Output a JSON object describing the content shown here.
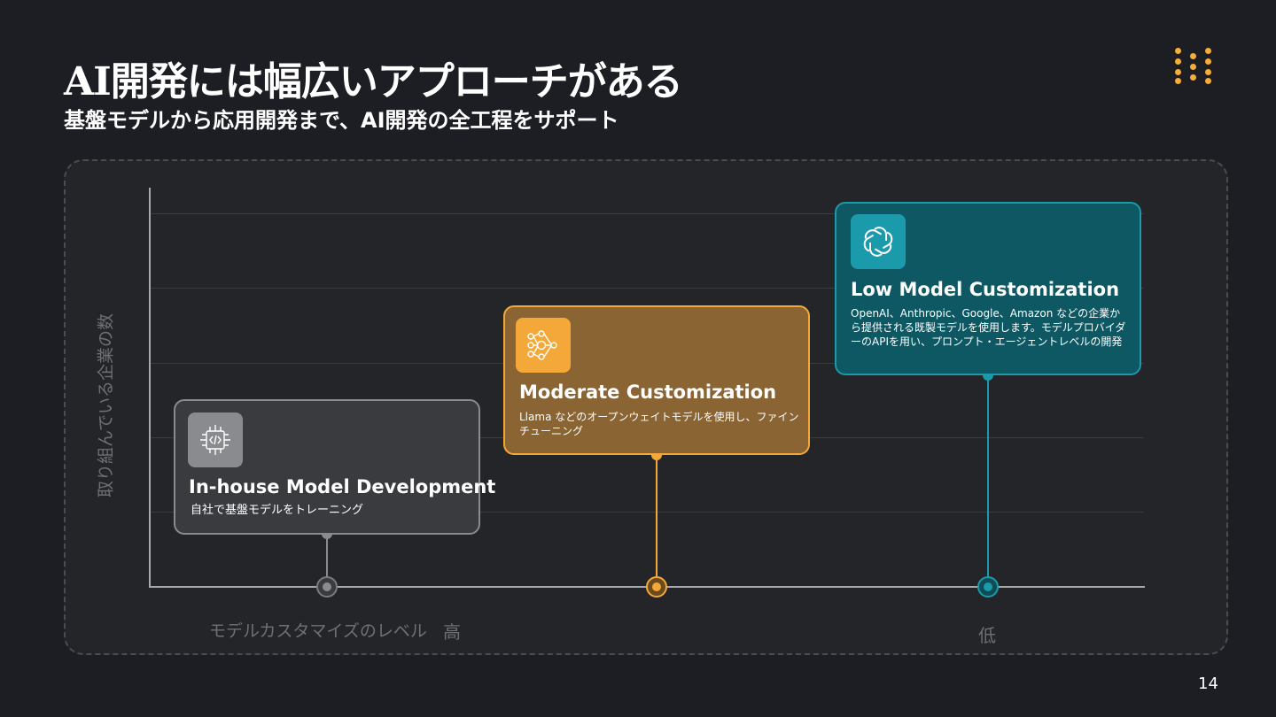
{
  "header": {
    "title": "AI開発には幅広いアプローチがある",
    "subtitle": "基盤モデルから応用開発まで、AI開発の全工程をサポート"
  },
  "chart": {
    "y_label": "取り組んでいる企業の数",
    "x_label": "モデルカスタマイズのレベル",
    "x_high": "高",
    "x_low": "低"
  },
  "cards": [
    {
      "title": "In-house Model Development",
      "description": "自社で基盤モデルをトレーニング",
      "icon": "chip-code-icon",
      "color": "#8a8b8f"
    },
    {
      "title": "Moderate Customization",
      "description": "Llama などのオープンウェイトモデルを使用し、ファインチューニング",
      "icon": "neural-network-icon",
      "color": "#f5a83a"
    },
    {
      "title": "Low Model Customization",
      "description": "OpenAI、Anthropic、Google、Amazon などの企業から提供される既製モデルを使用します。モデルプロバイダーのAPIを用い、プロンプト・エージェントレベルの開発",
      "icon": "openai-logo-icon",
      "color": "#1a9aaa"
    }
  ],
  "footer": {
    "page_number": "14"
  }
}
